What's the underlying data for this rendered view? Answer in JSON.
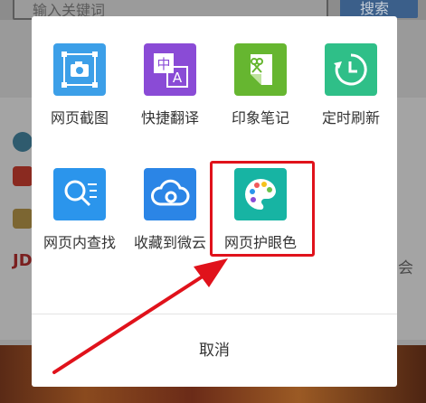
{
  "background": {
    "search_placeholder": "输入关键词",
    "search_button": "搜索",
    "logo_text": "JD",
    "side_text": "会"
  },
  "dialog": {
    "tools": [
      {
        "label": "网页截图",
        "icon": "screenshot-icon",
        "color": "#3c9fe8"
      },
      {
        "label": "快捷翻译",
        "icon": "translate-icon",
        "color": "#8a4bd6"
      },
      {
        "label": "印象笔记",
        "icon": "evernote-icon",
        "color": "#66b630"
      },
      {
        "label": "定时刷新",
        "icon": "timer-refresh-icon",
        "color": "#2fbf88"
      },
      {
        "label": "网页内查找",
        "icon": "find-in-page-icon",
        "color": "#2b95ec"
      },
      {
        "label": "收藏到微云",
        "icon": "weiyun-cloud-icon",
        "color": "#2b85e6"
      },
      {
        "label": "网页护眼色",
        "icon": "eye-care-palette-icon",
        "color": "#17b4a3"
      }
    ],
    "cancel_label": "取消"
  },
  "annotation": {
    "highlight_color": "#e0121b"
  }
}
